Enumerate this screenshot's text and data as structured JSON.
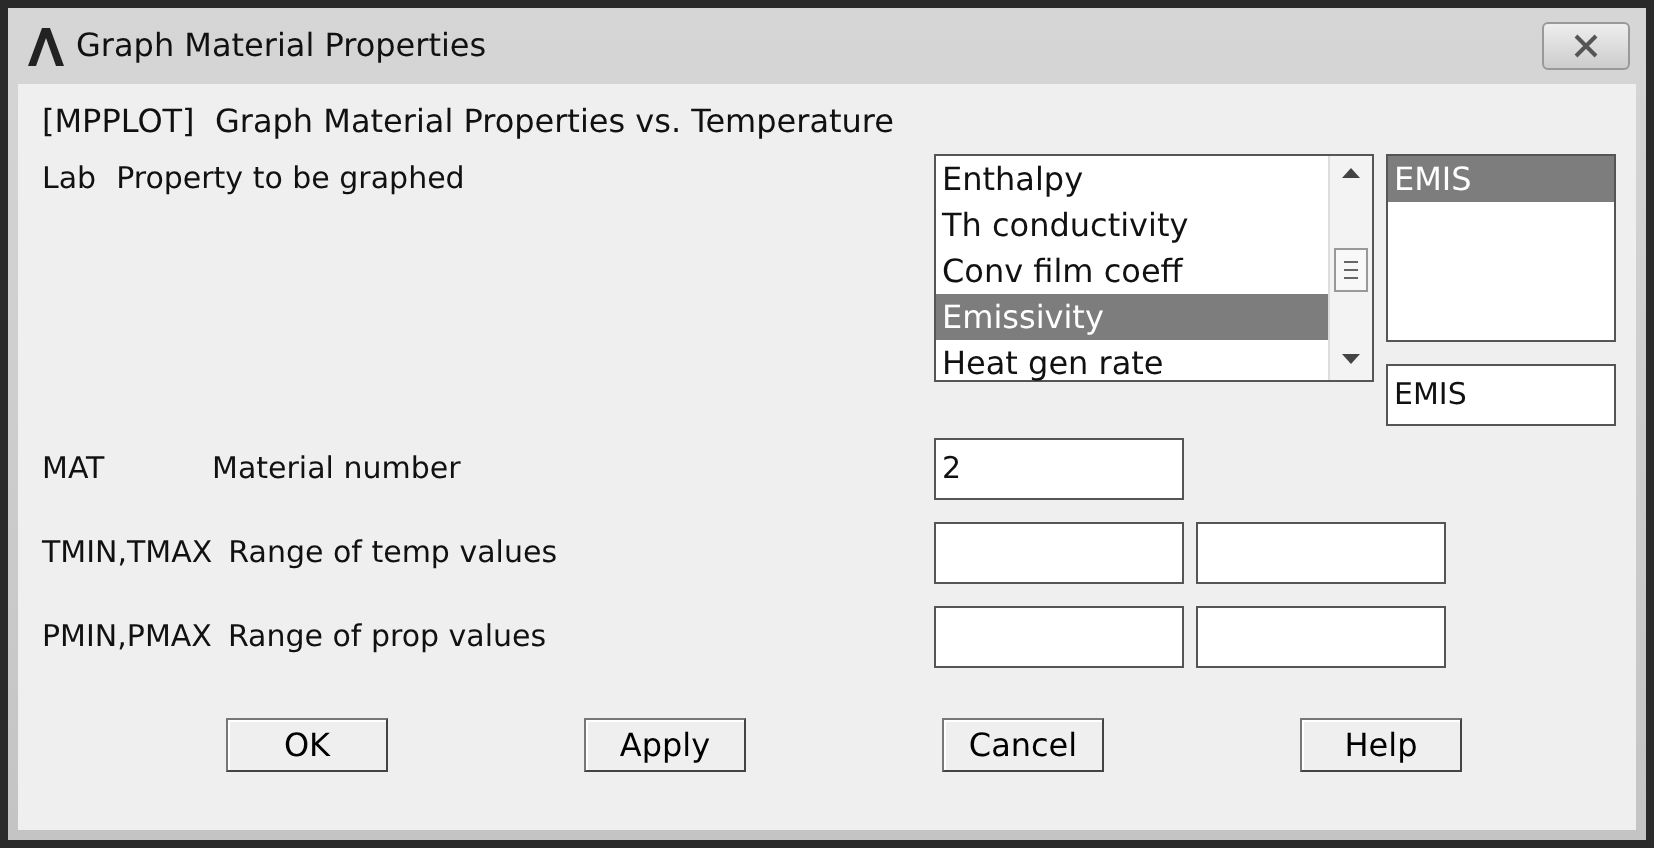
{
  "window": {
    "title": "Graph Material Properties"
  },
  "heading": "[MPPLOT]  Graph Material Properties vs. Temperature",
  "lab": {
    "code": "Lab",
    "label": "Property to be graphed",
    "options": [
      {
        "label": "Enthalpy",
        "selected": false
      },
      {
        "label": "Th conductivity",
        "selected": false
      },
      {
        "label": "Conv film coeff",
        "selected": false
      },
      {
        "label": "Emissivity",
        "selected": true
      },
      {
        "label": "Heat gen rate",
        "selected": false
      }
    ],
    "choices": [
      {
        "label": "EMIS",
        "selected": true
      }
    ],
    "value": "EMIS"
  },
  "fields": [
    {
      "code": "MAT",
      "label": "Material number",
      "kind": "single",
      "value": "2"
    },
    {
      "code": "TMIN,TMAX",
      "label": "Range of temp values",
      "kind": "pair"
    },
    {
      "code": "PMIN,PMAX",
      "label": "Range of prop values",
      "kind": "pair"
    }
  ],
  "buttons": [
    "OK",
    "Apply",
    "Cancel",
    "Help"
  ]
}
